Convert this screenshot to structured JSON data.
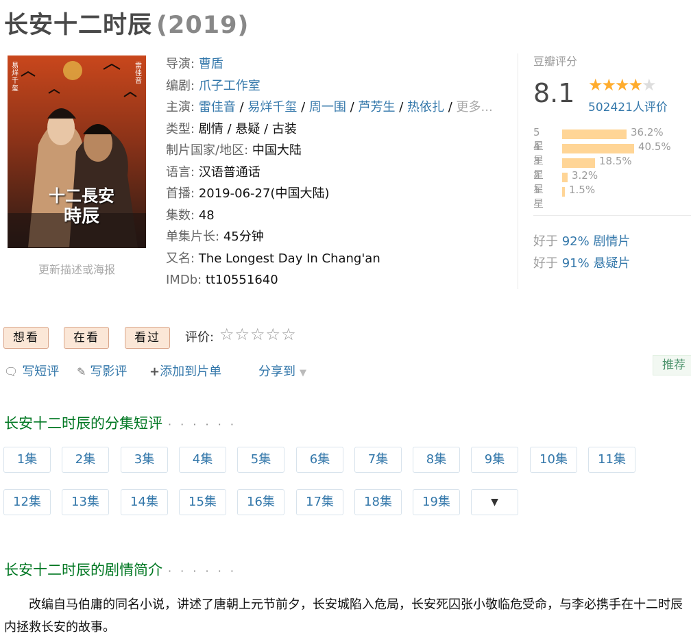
{
  "header": {
    "title": "长安十二时辰",
    "year": "(2019)"
  },
  "poster": {
    "caption": "更新描述或海报",
    "cast_left": "易烊千玺",
    "cast_right": "雷佳音",
    "logo_line1": "十二長安",
    "logo_line2": "時辰"
  },
  "info": {
    "director_label": "导演:",
    "director": "曹盾",
    "writer_label": "编剧:",
    "writer": "爪子工作室",
    "cast_label": "主演:",
    "cast": [
      "雷佳音",
      "易烊千玺",
      "周一围",
      "芦芳生",
      "热依扎"
    ],
    "cast_more": "更多...",
    "genre_label": "类型:",
    "genre": "剧情 / 悬疑 / 古装",
    "country_label": "制片国家/地区:",
    "country": "中国大陆",
    "language_label": "语言:",
    "language": "汉语普通话",
    "premiere_label": "首播:",
    "premiere": "2019-06-27(中国大陆)",
    "episodes_label": "集数:",
    "episodes": "48",
    "runtime_label": "单集片长:",
    "runtime": "45分钟",
    "aka_label": "又名:",
    "aka": "The Longest Day In Chang'an",
    "imdb_label": "IMDb:",
    "imdb": "tt10551640"
  },
  "rating": {
    "label": "豆瓣评分",
    "score": "8.1",
    "stars": 4,
    "votes": "502421人评价",
    "distribution": [
      {
        "label": "5星",
        "pct": "36.2%",
        "value": 36.2
      },
      {
        "label": "4星",
        "pct": "40.5%",
        "value": 40.5
      },
      {
        "label": "3星",
        "pct": "18.5%",
        "value": 18.5
      },
      {
        "label": "2星",
        "pct": "3.2%",
        "value": 3.2
      },
      {
        "label": "1星",
        "pct": "1.5%",
        "value": 1.5
      }
    ],
    "better": [
      {
        "prefix": "好于",
        "pct": "92%",
        "genre": "剧情片"
      },
      {
        "prefix": "好于",
        "pct": "91%",
        "genre": "悬疑片"
      }
    ]
  },
  "actions": {
    "want": "想看",
    "watching": "在看",
    "watched": "看过",
    "rate_label": "评价:",
    "short_review": "写短评",
    "long_review": "写影评",
    "add_list": "添加到片单",
    "share": "分享到",
    "recommend": "推荐"
  },
  "episodes_section": {
    "title": "长安十二时辰的分集短评",
    "dots": "· · · · · ·",
    "items": [
      "1集",
      "2集",
      "3集",
      "4集",
      "5集",
      "6集",
      "7集",
      "8集",
      "9集",
      "10集",
      "11集",
      "12集",
      "13集",
      "14集",
      "15集",
      "16集",
      "17集",
      "18集",
      "19集"
    ]
  },
  "summary_section": {
    "title": "长安十二时辰的剧情简介",
    "dots": "· · · · · ·",
    "text": "改编自马伯庸的同名小说，讲述了唐朝上元节前夕，长安城陷入危局，长安死囚张小敬临危受命，与李必携手在十二时辰内拯救长安的故事。"
  },
  "icons": {
    "comment": "speech-bubble-icon",
    "pen": "pencil-icon",
    "plus": "plus-icon",
    "dropdown": "triangle-down-icon"
  },
  "colors": {
    "link": "#3377aa",
    "star": "#ffac2d",
    "bar": "#ffd596",
    "section": "#007722",
    "button_bg": "#fbe7d7"
  }
}
